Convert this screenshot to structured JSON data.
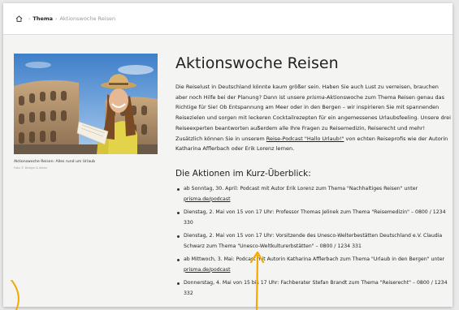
{
  "breadcrumb": {
    "home_icon": "home-icon",
    "separator": "›",
    "items": [
      "Thema",
      "Aktionswoche Reisen"
    ]
  },
  "image": {
    "caption": "Aktionswoche Reisen: Alles rund um Urlaub",
    "credit": "Foto © Design & Ideen"
  },
  "article": {
    "title": "Aktionswoche Reisen",
    "intro_parts": [
      "Die Reiselust in Deutschland könnte kaum größer sein. Haben Sie auch Lust zu verreisen, brauchen aber noch Hilfe bei der Planung? Dann ist unsere ",
      "prisma",
      "-Aktionswoche zum Thema Reisen genau das Richtige für Sie! Ob Entspannung am Meer oder in den Bergen – wir inspirieren Sie mit spannenden Reisezielen und sorgen mit leckeren Cocktailrezepten für ein angemessenes Urlaubsfeeling. Unsere drei Reiseexperten beantworten außerdem alle Ihre Fragen zu Reisemedizin, Reiserecht und mehr! Zusätzlich können Sie in unserem ",
      "Reise-Podcast \"Hallo Urlaub!\"",
      " von echten Reiseprofis wie der Autorin Katharina Afflerbach oder Erik Lorenz lernen."
    ],
    "subheading": "Die Aktionen im Kurz-Überblick:",
    "actions": [
      {
        "text": "ab Sonntag, 30. April: Podcast mit Autor Erik Lorenz zum Thema \"Nachhaltiges Reisen\" unter ",
        "link": "prisma.de/podcast",
        "tail": ""
      },
      {
        "text": "Dienstag, 2. Mai von 15 von 17 Uhr: Professor Thomas Jelinek zum Thema \"Reisemedizin\" – 0800 / 1234 330",
        "link": "",
        "tail": ""
      },
      {
        "text": "Dienstag, 2. Mai von 15 von 17 Uhr: Vorsitzende des Unesco-Welterbestätten Deutschland e.V. Claudia Schwarz zum Thema \"Unesco-Weltkulturerbstätten\" – 0800 / 1234 331",
        "link": "",
        "tail": ""
      },
      {
        "text": "ab Mittwoch, 3. Mai: Podcast mit Autorin Katharina Afflerbach zum Thema \"Urlaub in den Bergen\" unter ",
        "link": "prisma.de/podcast",
        "tail": ""
      },
      {
        "text": "Donnerstag, 4. Mai von 15 bis 17 Uhr: Fachberater Stefan Brandt zum Thema \"Reiserecht\" – 0800 / 1234 332",
        "link": "",
        "tail": ""
      }
    ]
  },
  "colors": {
    "page_bg": "#f4f4f3",
    "text": "#222222",
    "muted": "#9a9a9a",
    "annotation": "#f2a900"
  }
}
